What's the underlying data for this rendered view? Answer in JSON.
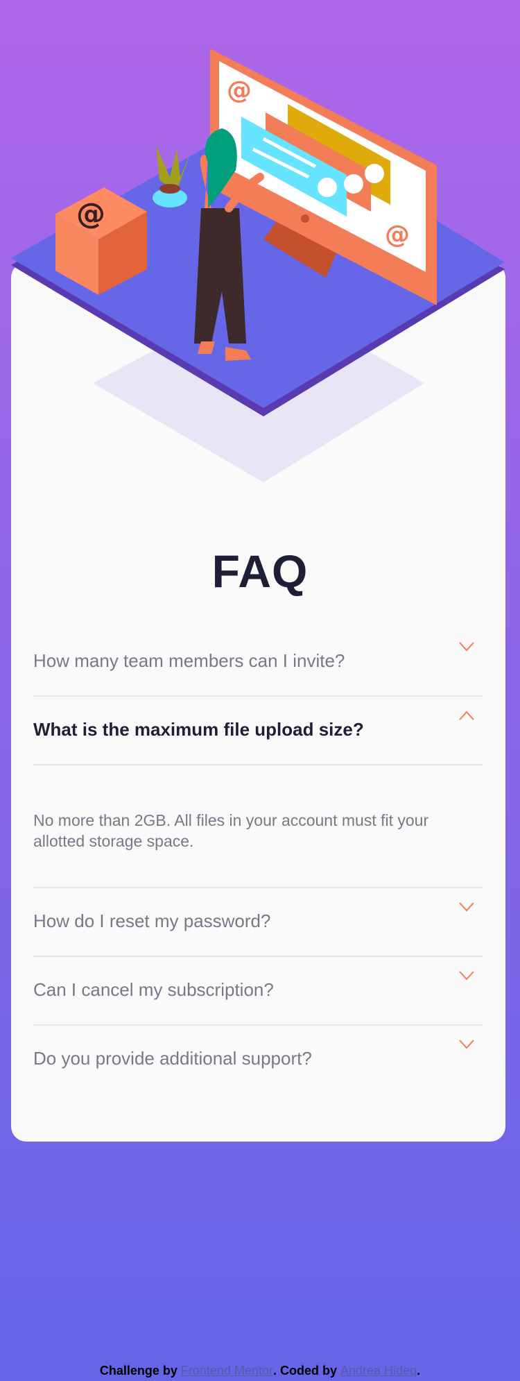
{
  "colors": {
    "bg_top": "#af67e9",
    "bg_bottom": "#6565e7",
    "card": "#fafafa",
    "title": "#1e1f36",
    "text_muted": "#787887",
    "accent": "#f47c57",
    "divider": "#e7e7e9"
  },
  "page_title": "FAQ",
  "faq": [
    {
      "question": "How many team members can I invite?",
      "open": false,
      "icon": "chevron-down-icon"
    },
    {
      "question": "What is the maximum file upload size?",
      "open": true,
      "icon": "chevron-up-icon",
      "answer": "No more than 2GB. All files in your account must fit your allotted storage space."
    },
    {
      "question": "How do I reset my password?",
      "open": false,
      "icon": "chevron-down-icon"
    },
    {
      "question": "Can I cancel my subscription?",
      "open": false,
      "icon": "chevron-down-icon"
    },
    {
      "question": "Do you provide additional support?",
      "open": false,
      "icon": "chevron-down-icon"
    }
  ],
  "attribution": {
    "prefix": "Challenge by",
    "challenge_link": "Frontend Mentor",
    "middle": ". Coded by",
    "author_link": "Andrea Hideq",
    "suffix": "."
  }
}
